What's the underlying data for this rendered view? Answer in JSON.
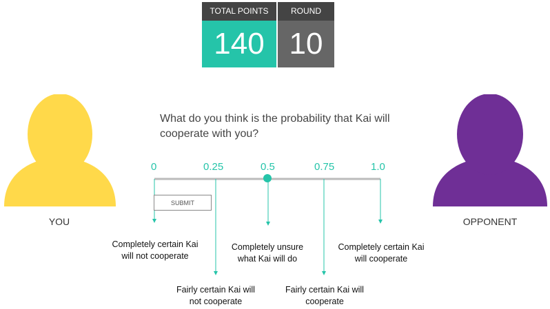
{
  "scoreboard": {
    "points_label": "TOTAL POINTS",
    "points_value": "140",
    "round_label": "ROUND",
    "round_value": "10"
  },
  "players": {
    "you": {
      "label": "YOU",
      "color": "#FFD94A",
      "icon": "person-silhouette-icon"
    },
    "opponent": {
      "label": "OPPONENT",
      "color": "#6F2F96",
      "icon": "person-silhouette-icon"
    }
  },
  "question": {
    "text": "What do you think is the probability that Kai will cooperate with you?"
  },
  "scale": {
    "accent_color": "#25C4A9",
    "ticks": [
      "0",
      "0.25",
      "0.5",
      "0.75",
      "1.0"
    ],
    "current_value": 0.5,
    "submit_label": "SUBMIT",
    "descriptions": {
      "d0": "Completely certain Kai will not cooperate",
      "d025": "Fairly certain Kai will not cooperate",
      "d05": "Completely unsure what Kai will do",
      "d075": "Fairly certain Kai will cooperate",
      "d1": "Completely certain Kai will cooperate"
    }
  }
}
